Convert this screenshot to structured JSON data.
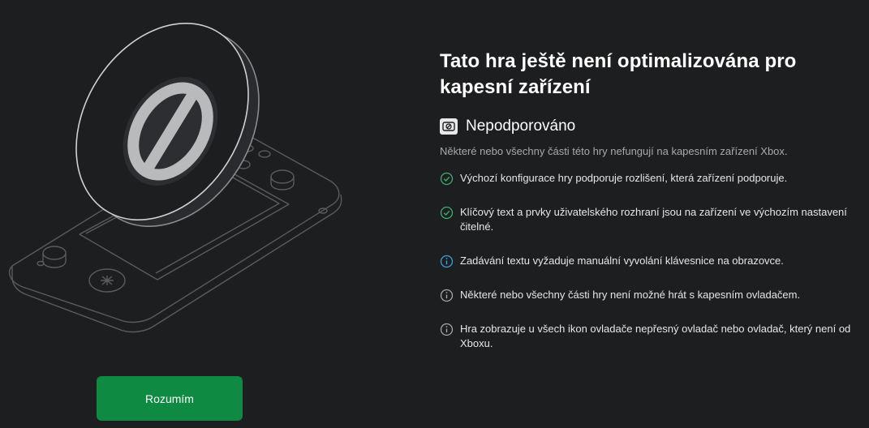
{
  "dialog": {
    "title": "Tato hra ještě není optimalizována pro kapesní zařízení",
    "status": {
      "icon": "unsupported-handheld-icon",
      "label": "Nepodporováno",
      "description": "Některé nebo všechny části této hry nefungují na kapesním zařízení Xbox."
    },
    "features": [
      {
        "icon": "check-circle-icon",
        "color": "#3fae6b",
        "text": "Výchozí konfigurace hry podporuje rozlišení, která zařízení podporuje."
      },
      {
        "icon": "check-circle-icon",
        "color": "#3fae6b",
        "text": "Klíčový text a prvky uživatelského rozhraní jsou na zařízení ve výchozím nastavení čitelné."
      },
      {
        "icon": "info-circle-icon",
        "color": "#3aa0e0",
        "text": "Zadávání textu vyžaduje manuální vyvolání klávesnice na obrazovce."
      },
      {
        "icon": "info-circle-icon",
        "color": "#a6a6a6",
        "text": "Některé nebo všechny části hry není možné hrát s kapesním ovladačem."
      },
      {
        "icon": "info-circle-icon",
        "color": "#a6a6a6",
        "text": "Hra zobrazuje u všech ikon ovladače nepřesný ovladač nebo ovladač, který není od Xboxu."
      }
    ],
    "button_label": "Rozumím",
    "accent_color": "#0e8a43",
    "illustration_icon": "handheld-prohibited-icon"
  }
}
